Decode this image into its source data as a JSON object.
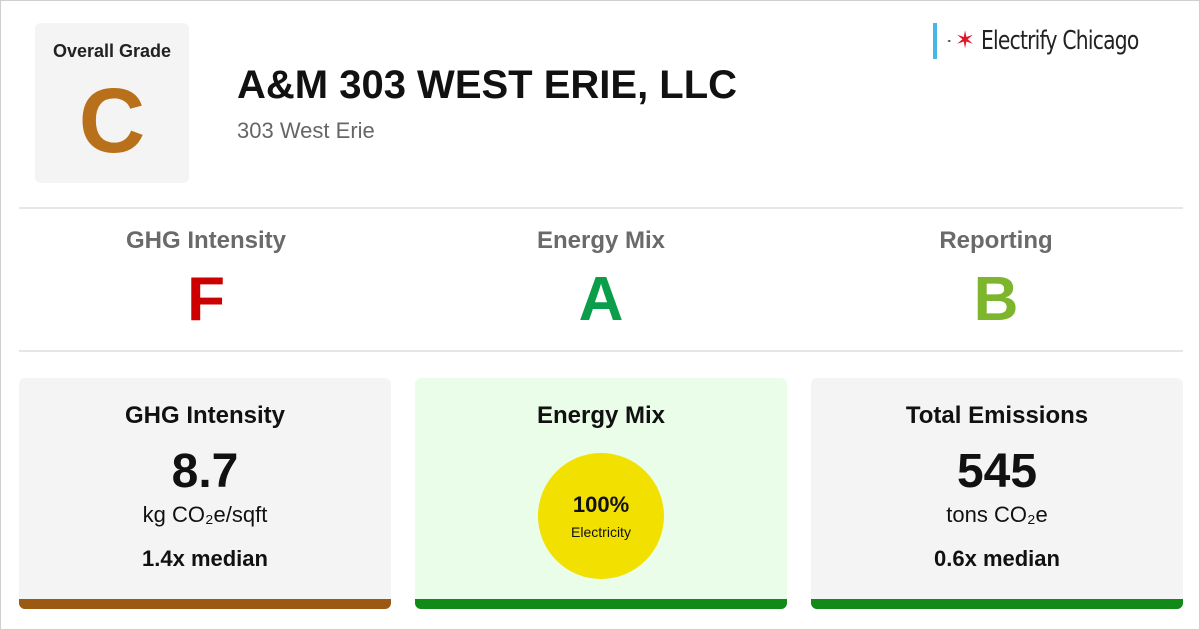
{
  "header": {
    "overall_grade_label": "Overall Grade",
    "overall_grade": "C",
    "building_name": "A&M 303 WEST ERIE, LLC",
    "address": "303 West Erie",
    "brand_name": "Electrify Chicago",
    "brand_icons": [
      "chicago-flag-icon",
      "plug-icon",
      "red-star-icon"
    ]
  },
  "grades": [
    {
      "label": "GHG Intensity",
      "grade": "F"
    },
    {
      "label": "Energy Mix",
      "grade": "A"
    },
    {
      "label": "Reporting",
      "grade": "B"
    }
  ],
  "cards": {
    "ghg": {
      "title": "GHG Intensity",
      "value": "8.7",
      "unit": "kg CO₂e/sqft",
      "median": "1.4x median"
    },
    "mix": {
      "title": "Energy Mix",
      "percent": "100%",
      "source": "Electricity"
    },
    "emissions": {
      "title": "Total Emissions",
      "value": "545",
      "unit": "tons CO₂e",
      "median": "0.6x median"
    }
  },
  "colors": {
    "grade_c": "#b8711a",
    "grade_f": "#cc0000",
    "grade_a": "#0a9e4a",
    "grade_b": "#7db52c",
    "card_neutral_bg": "#f4f4f4",
    "card_good_bg": "#eafde8",
    "bar_bad": "#9b5a12",
    "bar_good": "#118a18",
    "mix_circle": "#f1e000",
    "brand_flag": "#46b7e6",
    "brand_star": "#e0172a"
  }
}
